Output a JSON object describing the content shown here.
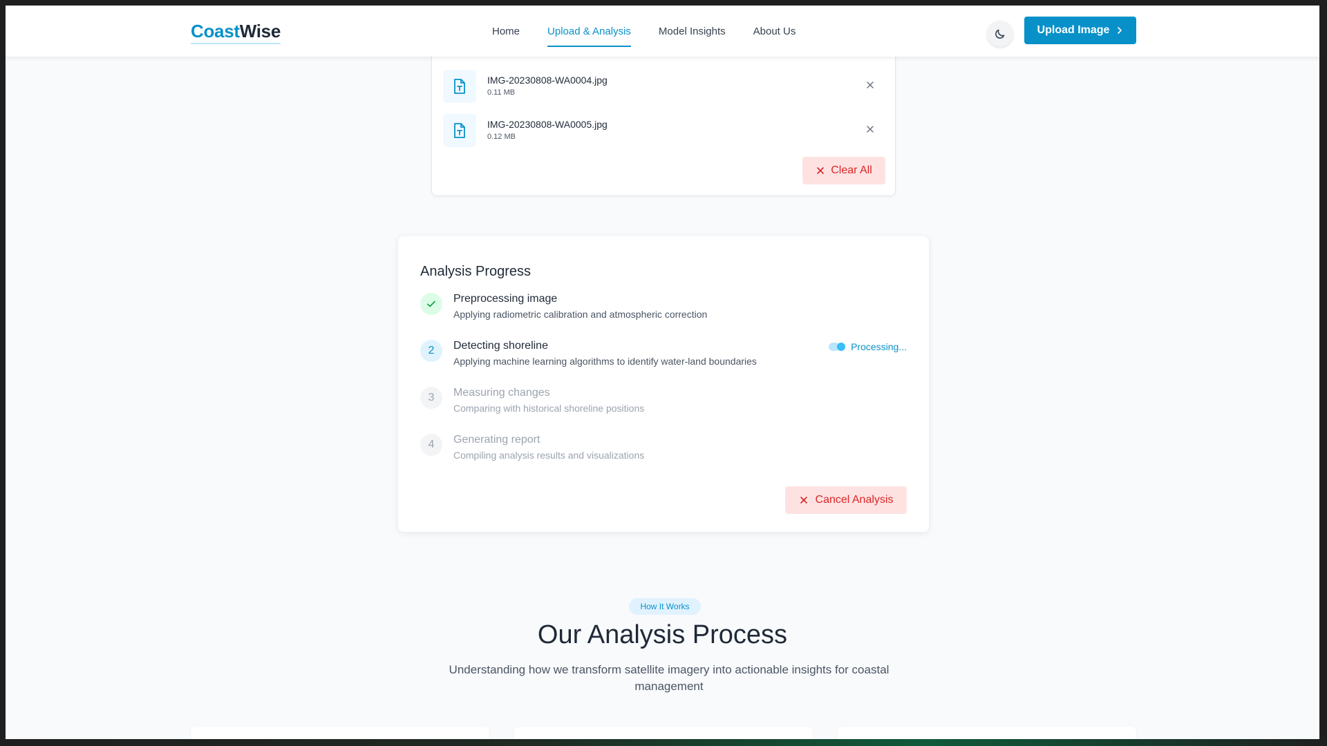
{
  "header": {
    "logo_part1": "Coast",
    "logo_part2": "Wise",
    "nav": [
      {
        "label": "Home",
        "active": false
      },
      {
        "label": "Upload & Analysis",
        "active": true
      },
      {
        "label": "Model Insights",
        "active": false
      },
      {
        "label": "About Us",
        "active": false
      }
    ],
    "theme_icon": "moon-icon",
    "upload_button": "Upload Image",
    "accent_color": "#0891c9"
  },
  "files": {
    "items": [
      {
        "name": "IMG-20230808-WA0004.jpg",
        "size": "0.11 MB"
      },
      {
        "name": "IMG-20230808-WA0005.jpg",
        "size": "0.12 MB"
      }
    ],
    "clear_all": "Clear All"
  },
  "analysis": {
    "title": "Analysis Progress",
    "steps": [
      {
        "marker": "✓",
        "state": "done",
        "title": "Preprocessing image",
        "desc": "Applying radiometric calibration and atmospheric correction"
      },
      {
        "marker": "2",
        "state": "active",
        "title": "Detecting shoreline",
        "desc": "Applying machine learning algorithms to identify water-land boundaries",
        "status": "Processing..."
      },
      {
        "marker": "3",
        "state": "pending",
        "title": "Measuring changes",
        "desc": "Comparing with historical shoreline positions"
      },
      {
        "marker": "4",
        "state": "pending",
        "title": "Generating report",
        "desc": "Compiling analysis results and visualizations"
      }
    ],
    "cancel_button": "Cancel Analysis"
  },
  "how_it_works": {
    "badge": "How It Works",
    "title": "Our Analysis Process",
    "subtitle": "Understanding how we transform satellite imagery into actionable insights for coastal management"
  }
}
